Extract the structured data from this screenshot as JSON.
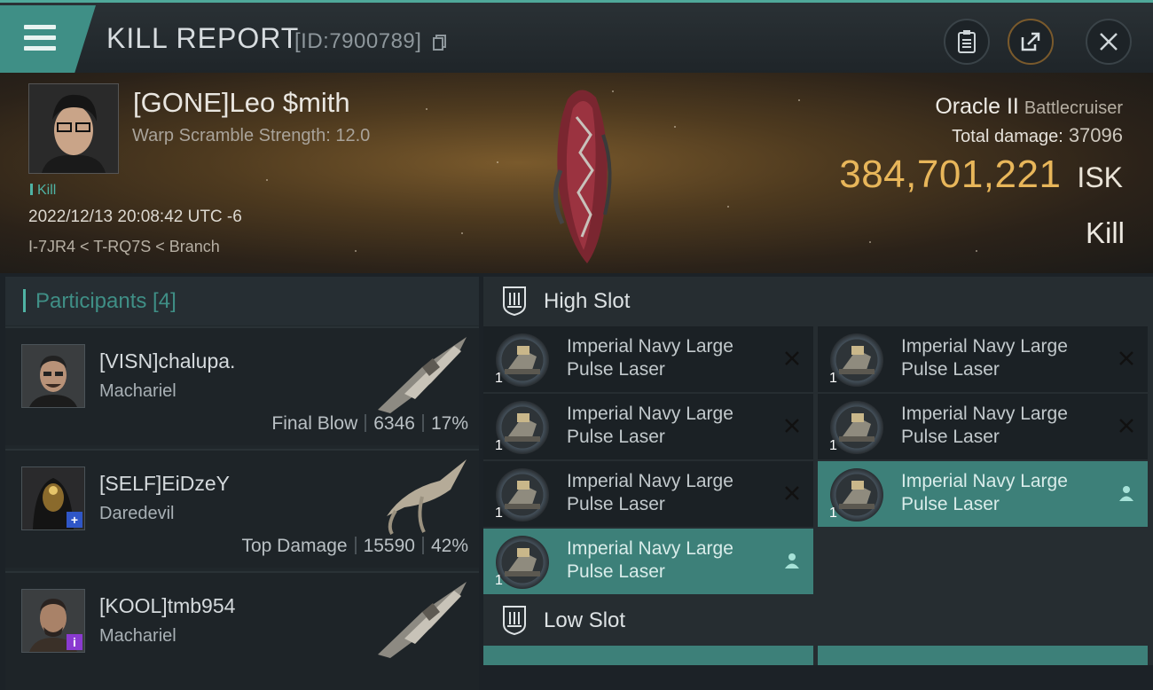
{
  "header": {
    "title": "KILL REPORT",
    "report_id": "[ID:7900789]"
  },
  "victim": {
    "name": "[GONE]Leo $mith",
    "warp_scramble": "Warp Scramble Strength: 12.0",
    "tag": "Kill",
    "datetime": "2022/12/13 20:08:42 UTC -6",
    "location": "I-7JR4 < T-RQ7S < Branch",
    "ship_name": "Oracle II",
    "ship_class": "Battlecruiser",
    "total_damage_label": "Total damage:",
    "total_damage": "37096",
    "isk_value": "384,701,221",
    "isk_unit": "ISK",
    "result": "Kill"
  },
  "participants": {
    "label": "Participants [4]",
    "rows": [
      {
        "name": "[VISN]chalupa.",
        "ship": "Machariel",
        "role": "Final Blow",
        "damage": "6346",
        "percent": "17%"
      },
      {
        "name": "[SELF]EiDzeY",
        "ship": "Daredevil",
        "role": "Top Damage",
        "damage": "15590",
        "percent": "42%",
        "badge": "+"
      },
      {
        "name": "[KOOL]tmb954",
        "ship": "Machariel",
        "badge": "i"
      }
    ]
  },
  "slots": {
    "high_slot_label": "High Slot",
    "low_slot_label": "Low Slot",
    "modules": [
      {
        "name": "Imperial Navy Large Pulse Laser",
        "qty": "1",
        "status": "destroyed-icon"
      },
      {
        "name": "Imperial Navy Large Pulse Laser",
        "qty": "1",
        "status": "destroyed-icon"
      },
      {
        "name": "Imperial Navy Large Pulse Laser",
        "qty": "1",
        "status": "destroyed-icon"
      },
      {
        "name": "Imperial Navy Large Pulse Laser",
        "qty": "1",
        "status": "destroyed-icon"
      },
      {
        "name": "Imperial Navy Large Pulse Laser",
        "qty": "1",
        "status": "destroyed-icon"
      },
      {
        "name": "Imperial Navy Large Pulse Laser",
        "qty": "1",
        "status": "dropped-icon"
      },
      {
        "name": "Imperial Navy Large Pulse Laser",
        "qty": "1",
        "status": "dropped-icon"
      }
    ]
  },
  "colors": {
    "accent": "#4fb3a4",
    "isk": "#e8b65a",
    "fitted_bg": "#3d8079"
  }
}
